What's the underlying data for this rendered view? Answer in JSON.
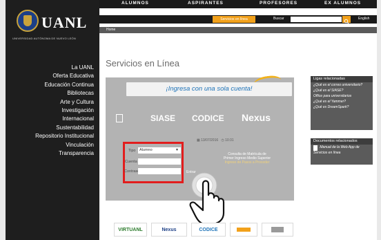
{
  "topnav": {
    "items": [
      "ALUMNOS",
      "ASPIRANTES",
      "PROFESORES",
      "EX ALUMNOS"
    ]
  },
  "utility": {
    "services_button": "Servicios en línea",
    "search_label": "Buscar",
    "search_placeholder": "",
    "language": "English"
  },
  "breadcrumb": "Home",
  "logo": {
    "name": "UANL",
    "university": "UNIVERSIDAD AUTÓNOMA DE NUEVO LEÓN"
  },
  "sidebar": {
    "items": [
      "La UANL",
      "Oferta Educativa",
      "Educación Continua",
      "Bibliotecas",
      "Arte y Cultura",
      "Investigación",
      "Internacional",
      "Sustentabilidad",
      "Repositorio Institucional",
      "Vinculación",
      "Transparencia"
    ]
  },
  "page_title": "Servicios en Línea",
  "login": {
    "tagline": "¡Ingresa con una sola cuenta!",
    "systems": [
      "SIASE",
      "CODICE",
      "Nexus"
    ],
    "date": "13/07/2016",
    "time": "10:31",
    "tipo_label": "Tipo",
    "tipo_value": "Alumno",
    "cuenta_label": "Cuenta",
    "password_label": "Contraseña",
    "enter_label": "Entrar",
    "consulta_line1": "Consulta de Matrícula de",
    "consulta_line2": "Primer Ingreso Medio Superior",
    "consulta_line3": "Ingreso de Pasos a Proceder"
  },
  "right": {
    "ligas_title": "Ligas relacionadas",
    "ligas": [
      "¿Qué es el correo universitario?",
      "¿Qué es el SIASE?",
      "Office para universitarios",
      "¿Qué es el Yammer?",
      "¿Qué es DreamSpark?"
    ],
    "docs_title": "Documentos relacionados",
    "docs": [
      "Manual de la Web App de Servicios en línea"
    ]
  },
  "bottom_logos": [
    "VIRTUANL",
    "Nexus",
    "CODICE",
    "",
    ""
  ],
  "colors": {
    "accent": "#f2a11b",
    "highlight": "#e21d1d",
    "sidebar": "#1e1e1e",
    "tagline": "#1e73b8"
  }
}
